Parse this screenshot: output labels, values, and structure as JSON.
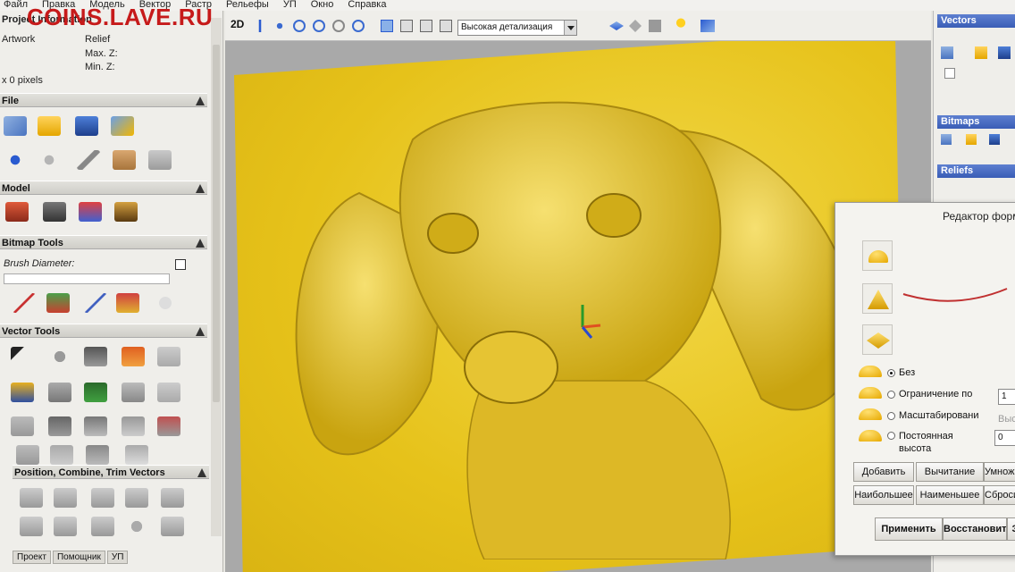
{
  "menubar": [
    "Файл",
    "Правка",
    "Модель",
    "Вектор",
    "Растр",
    "Рельефы",
    "УП",
    "Окно",
    "Справка"
  ],
  "watermark": "COINS.LAVE.RU",
  "project_info": {
    "title": "Project Information",
    "artwork": "Artwork",
    "relief": "Relief",
    "max_z": "Max. Z:",
    "min_z": "Min. Z:",
    "pixels": "x 0 pixels"
  },
  "panels": {
    "file": "File",
    "model": "Model",
    "bitmap_tools": "Bitmap Tools",
    "brush_diameter": "Brush Diameter:",
    "vector_tools": "Vector Tools",
    "position": "Position, Combine, Trim Vectors"
  },
  "tabs": [
    "Проект",
    "Помощник",
    "УП"
  ],
  "view_toolbar": {
    "mode": "2D",
    "quality": "Высокая детализация"
  },
  "right_panel": {
    "vectors": "Vectors",
    "bitmaps": "Bitmaps",
    "reliefs": "Reliefs"
  },
  "shape_editor": {
    "title": "Редактор формы",
    "options": [
      {
        "label": "Без",
        "selected": true
      },
      {
        "label": "Ограничение по",
        "selected": false
      },
      {
        "label": "Масштабировани",
        "selected": false
      },
      {
        "label": "Постоянная высота",
        "selected": false
      }
    ],
    "fields": [
      "1",
      "0"
    ],
    "side_label": "Выс",
    "buttons_row1": [
      "Добавить",
      "Вычитание",
      "Умножить"
    ],
    "buttons_row2": [
      "Наибольшее",
      "Наименьшее",
      "Сбросить"
    ],
    "buttons_row3": [
      "Применить",
      "Восстановить",
      "З"
    ]
  },
  "colors": {
    "relief": "#e6c21a",
    "accent": "#3a5db6"
  }
}
